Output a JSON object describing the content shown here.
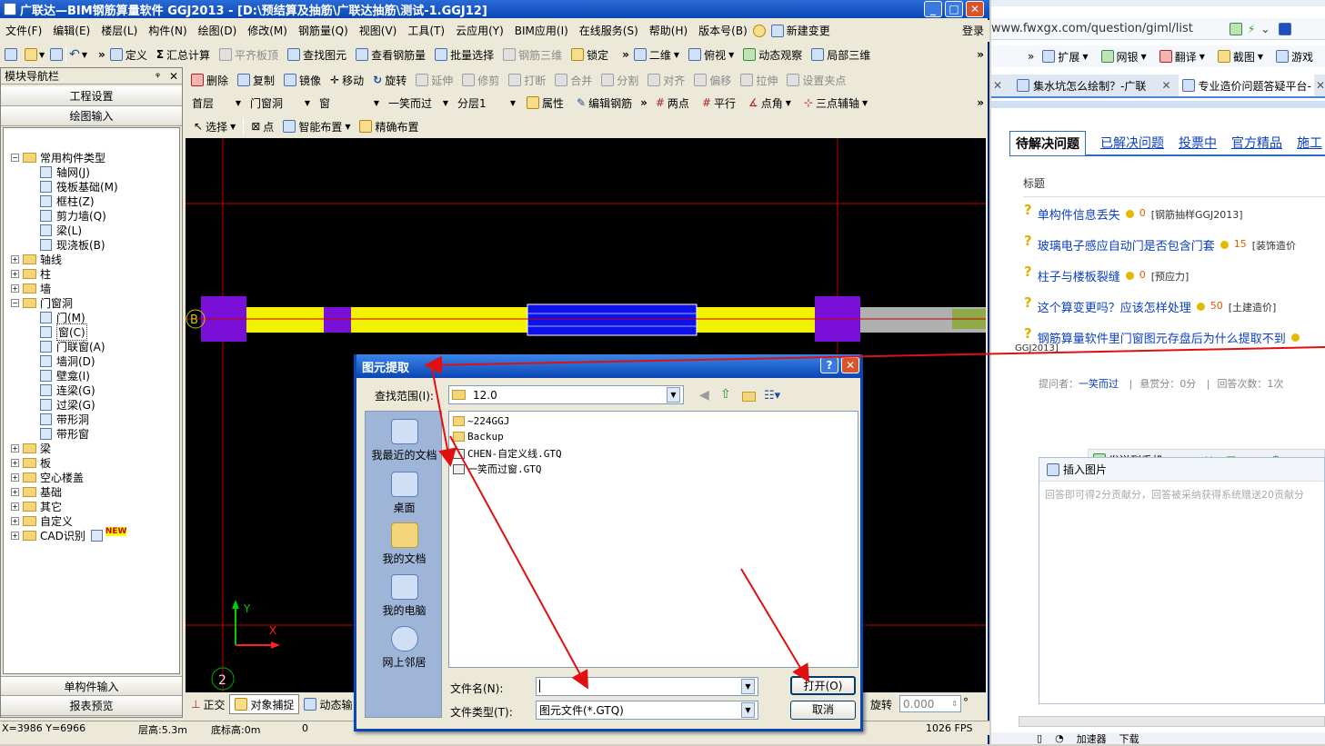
{
  "app": {
    "title": "广联达—BIM钢筋算量软件 GGJ2013 - [D:\\预结算及抽筋\\广联达抽筋\\测试-1.GGJ12]",
    "menu": [
      "文件(F)",
      "编辑(E)",
      "楼层(L)",
      "构件(N)",
      "绘图(D)",
      "修改(M)",
      "钢筋量(Q)",
      "视图(V)",
      "工具(T)",
      "云应用(Y)",
      "BIM应用(I)",
      "在线服务(S)",
      "帮助(H)",
      "版本号(B)",
      "新建变更"
    ],
    "login": "登录",
    "toolbar1": [
      {
        "label": "定义",
        "disabled": false
      },
      {
        "label": "汇总计算",
        "disabled": false
      },
      {
        "label": "平齐板顶",
        "disabled": true
      },
      {
        "label": "查找图元",
        "disabled": false
      },
      {
        "label": "查看钢筋量",
        "disabled": false
      },
      {
        "label": "批量选择",
        "disabled": false
      },
      {
        "label": "钢筋三维",
        "disabled": true
      },
      {
        "label": "锁定",
        "disabled": false
      },
      {
        "label": "二维",
        "disabled": false
      },
      {
        "label": "俯视",
        "disabled": false
      },
      {
        "label": "动态观察",
        "disabled": false
      },
      {
        "label": "局部三维",
        "disabled": false
      }
    ],
    "toolbar2": [
      {
        "label": "删除",
        "disabled": false
      },
      {
        "label": "复制",
        "disabled": false
      },
      {
        "label": "镜像",
        "disabled": false
      },
      {
        "label": "移动",
        "disabled": false
      },
      {
        "label": "旋转",
        "disabled": false
      },
      {
        "label": "延伸",
        "disabled": true
      },
      {
        "label": "修剪",
        "disabled": true
      },
      {
        "label": "打断",
        "disabled": true
      },
      {
        "label": "合并",
        "disabled": true
      },
      {
        "label": "分割",
        "disabled": true
      },
      {
        "label": "对齐",
        "disabled": true
      },
      {
        "label": "偏移",
        "disabled": true
      },
      {
        "label": "拉伸",
        "disabled": true
      },
      {
        "label": "设置夹点",
        "disabled": true
      }
    ],
    "toolbar3": {
      "floor": "首层",
      "category": "门窗洞",
      "type": "窗",
      "component": "一笑而过",
      "layer": "分层1",
      "properties": "属性",
      "edit_rebar": "编辑钢筋",
      "two_points": "两点",
      "parallel": "平行",
      "point_angle": "点角",
      "three_point_axis": "三点辅轴"
    },
    "toolbar4": {
      "select": "选择",
      "point": "点",
      "smart_layout": "智能布置",
      "precise_layout": "精确布置"
    },
    "nav": {
      "title": "模块导航栏",
      "project_settings": "工程设置",
      "drawing_input": "绘图输入",
      "single_input": "单构件输入",
      "report_preview": "报表预览",
      "tree": [
        {
          "label": "常用构件类型",
          "level": 0,
          "type": "folder",
          "expanded": true
        },
        {
          "label": "轴网(J)",
          "level": 1,
          "type": "item"
        },
        {
          "label": "筏板基础(M)",
          "level": 1,
          "type": "item"
        },
        {
          "label": "框柱(Z)",
          "level": 1,
          "type": "item"
        },
        {
          "label": "剪力墙(Q)",
          "level": 1,
          "type": "item"
        },
        {
          "label": "梁(L)",
          "level": 1,
          "type": "item"
        },
        {
          "label": "现浇板(B)",
          "level": 1,
          "type": "item"
        },
        {
          "label": "轴线",
          "level": 0,
          "type": "folder",
          "expanded": false
        },
        {
          "label": "柱",
          "level": 0,
          "type": "folder",
          "expanded": false
        },
        {
          "label": "墙",
          "level": 0,
          "type": "folder",
          "expanded": false
        },
        {
          "label": "门窗洞",
          "level": 0,
          "type": "folder",
          "expanded": true
        },
        {
          "label": "门(M)",
          "level": 1,
          "type": "item"
        },
        {
          "label": "窗(C)",
          "level": 1,
          "type": "item",
          "selected": true
        },
        {
          "label": "门联窗(A)",
          "level": 1,
          "type": "item"
        },
        {
          "label": "墙洞(D)",
          "level": 1,
          "type": "item"
        },
        {
          "label": "壁龛(I)",
          "level": 1,
          "type": "item"
        },
        {
          "label": "连梁(G)",
          "level": 1,
          "type": "item"
        },
        {
          "label": "过梁(G)",
          "level": 1,
          "type": "item"
        },
        {
          "label": "带形洞",
          "level": 1,
          "type": "item"
        },
        {
          "label": "带形窗",
          "level": 1,
          "type": "item"
        },
        {
          "label": "梁",
          "level": 0,
          "type": "folder",
          "expanded": false
        },
        {
          "label": "板",
          "level": 0,
          "type": "folder",
          "expanded": false
        },
        {
          "label": "空心楼盖",
          "level": 0,
          "type": "folder",
          "expanded": false
        },
        {
          "label": "基础",
          "level": 0,
          "type": "folder",
          "expanded": false
        },
        {
          "label": "其它",
          "level": 0,
          "type": "folder",
          "expanded": false
        },
        {
          "label": "自定义",
          "level": 0,
          "type": "folder",
          "expanded": false
        },
        {
          "label": "CAD识别",
          "level": 0,
          "type": "folder",
          "expanded": false,
          "badge": "NEW"
        }
      ]
    },
    "canvas": {
      "axis_y": "Y",
      "axis_x": "X",
      "grid_label_bottom": "2",
      "grid_label_left": "B"
    },
    "bottom_tools": {
      "ortho": "正交",
      "snap": "对象捕捉",
      "dynamic": "动态输",
      "rotate_label": "旋转",
      "rotate_value": "0.000",
      "degree": "°"
    },
    "status": {
      "coords": "X=3986 Y=6966",
      "floor_height": "层高:5.3m",
      "bottom_elev": "底标高:0m",
      "zero": "0",
      "fps": "1026 FPS"
    }
  },
  "dialog": {
    "title": "图元提取",
    "look_in_label": "查找范围(I):",
    "look_in_value": "12.0",
    "places": [
      "我最近的文档",
      "桌面",
      "我的文档",
      "我的电脑",
      "网上邻居"
    ],
    "files": [
      {
        "name": "~224GGJ",
        "kind": "folder"
      },
      {
        "name": "Backup",
        "kind": "folder"
      },
      {
        "name": "CHEN-自定义线.GTQ",
        "kind": "file"
      },
      {
        "name": "一笑而过窗.GTQ",
        "kind": "file"
      }
    ],
    "filename_label": "文件名(N):",
    "filename_value": "",
    "filetype_label": "文件类型(T):",
    "filetype_value": "图元文件(*.GTQ)",
    "open_button": "打开(O)",
    "cancel_button": "取消"
  },
  "browser": {
    "url": "www.fwxgx.com/question/giml/list",
    "toolbar": [
      "扩展",
      "网银",
      "翻译",
      "截图",
      "游戏"
    ],
    "tabs": [
      "集水坑怎么绘制？-广联",
      "专业造价问题答疑平台-"
    ],
    "section_tabs": [
      "待解决问题",
      "已解决问题",
      "投票中",
      "官方精品",
      "施工"
    ],
    "header": "标题",
    "questions": [
      {
        "title": "单构件信息丢失",
        "score": "0",
        "tag": "[钢筋抽样GGJ2013]"
      },
      {
        "title": "玻璃电子感应自动门是否包含门套",
        "score": "15",
        "tag": "[装饰造价"
      },
      {
        "title": "柱子与楼板裂缝",
        "score": "0",
        "tag": "[预应力]"
      },
      {
        "title": "这个算变更吗？应该怎样处理",
        "score": "50",
        "tag": "[土建造价]"
      },
      {
        "title": "钢筋算量软件里门窗图元存盘后为什么提取不到",
        "score": "",
        "tag": "GGJ2013]"
      }
    ],
    "meta": {
      "asker_label": "提问者：",
      "asker": "一笑而过",
      "bounty": "悬赏分：0分",
      "answers": "回答次数：1次"
    },
    "send_phone": "发送到手机",
    "insert_image": "插入图片",
    "answer_placeholder": "回答即可得2分贡献分，回答被采纳获得系统赠送20贡献分",
    "bottom": [
      "加速器",
      "下载"
    ]
  },
  "colors": {
    "wall_yellow": "#f2f200",
    "column_purple": "#7a10d8",
    "window_blue": "#1010e8",
    "gridline_red": "#c00000",
    "arrow_red": "#e01010",
    "link_blue": "#0b3fbf"
  }
}
